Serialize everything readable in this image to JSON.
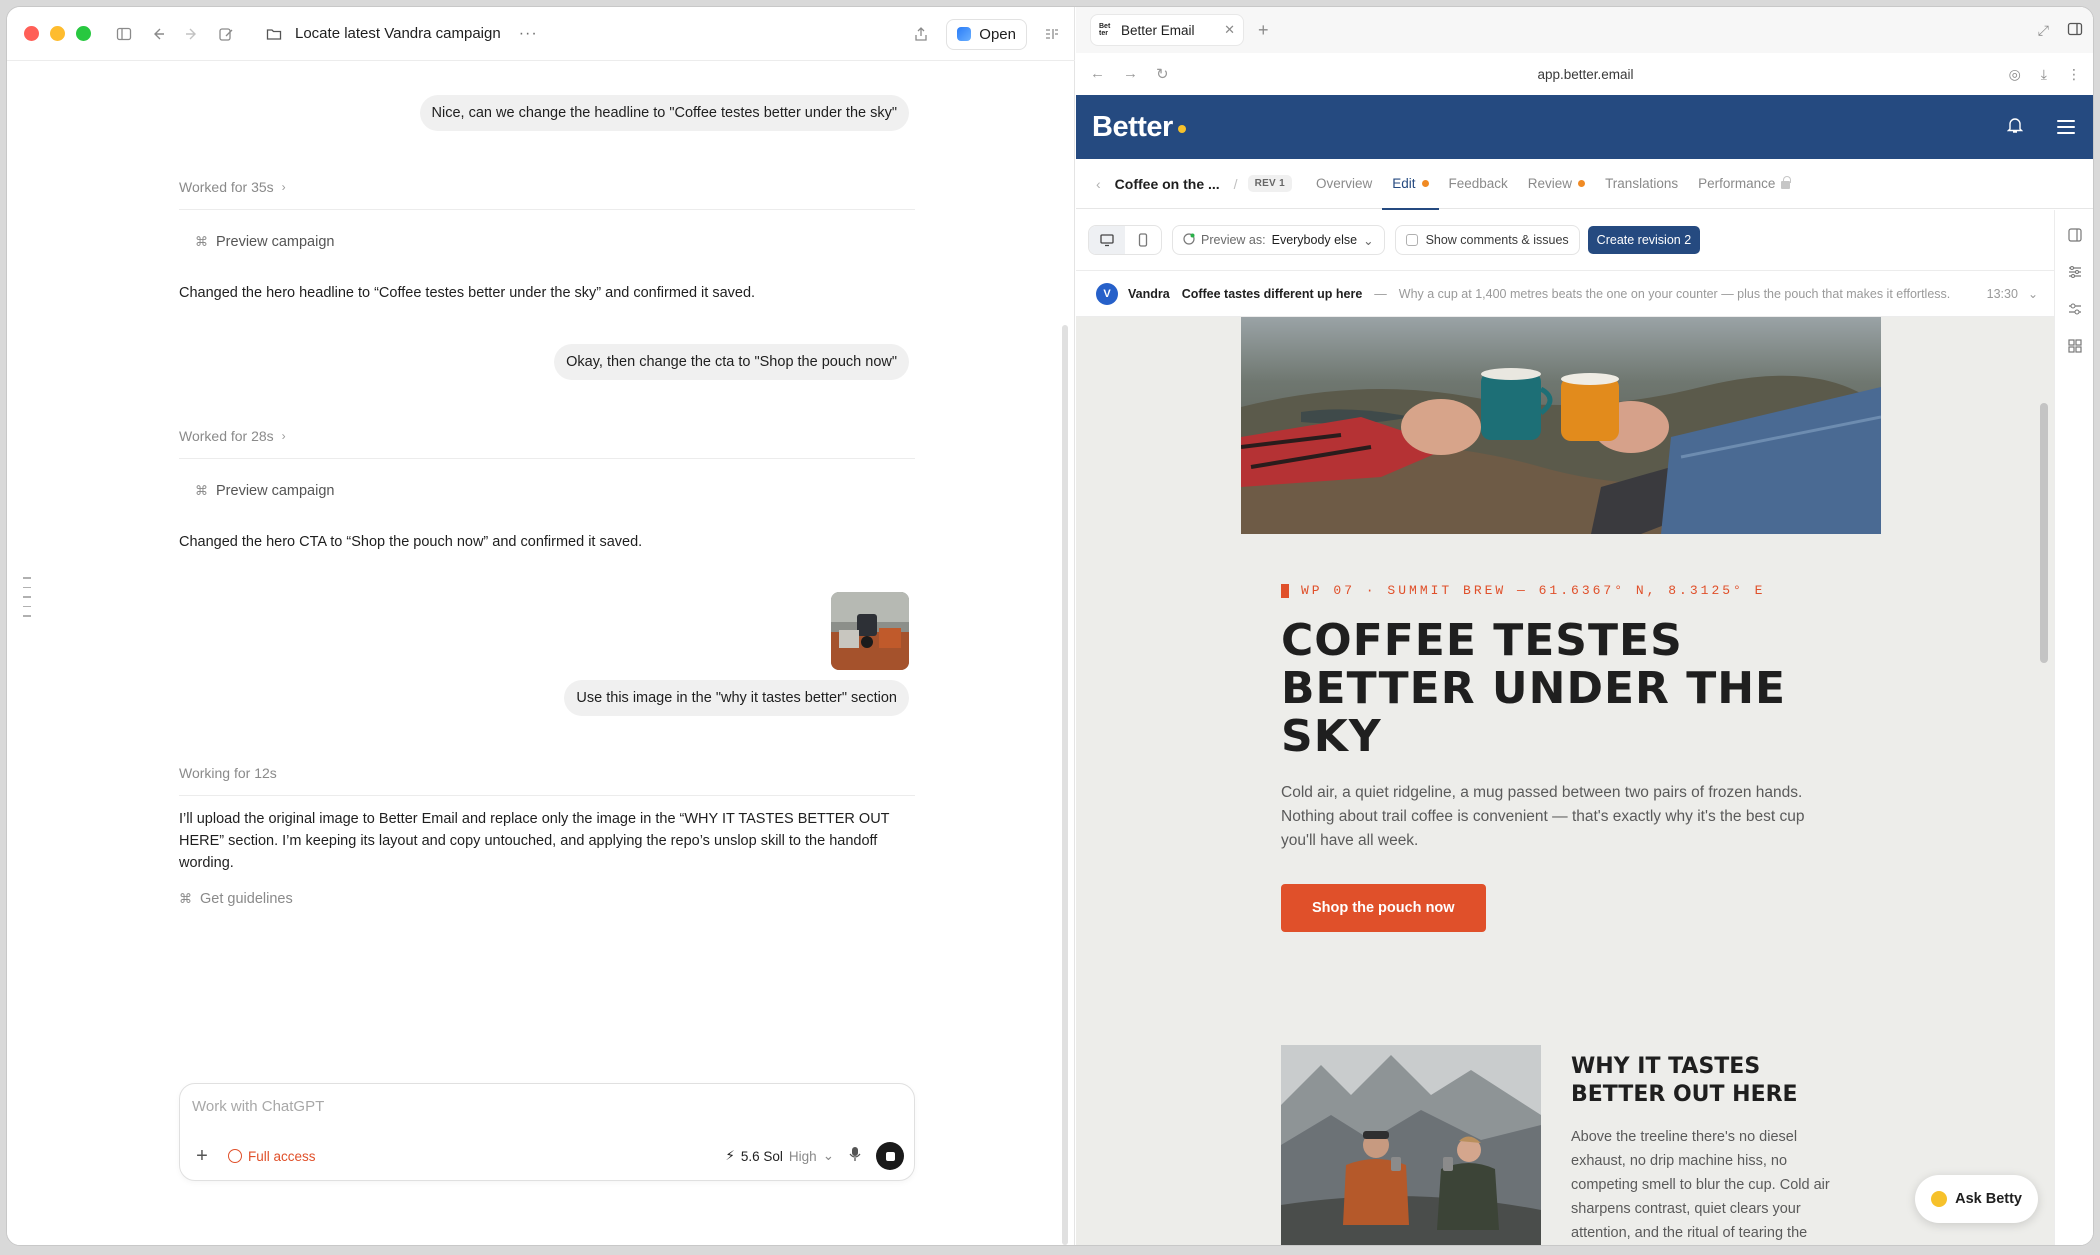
{
  "left": {
    "window_title": "Locate latest Vandra campaign",
    "more": "···",
    "open_label": "Open",
    "messages": {
      "user1": "Nice, can we change the headline to \"Coffee testes better under the sky\"",
      "worked1": "Worked for 35s",
      "tool1": "Preview campaign",
      "reply1": "Changed the hero headline to “Coffee testes better under the sky” and confirmed it saved.",
      "user2": "Okay, then change the cta to \"Shop the pouch now\"",
      "worked2": "Worked for 28s",
      "tool2": "Preview campaign",
      "reply2": "Changed the hero CTA to “Shop the pouch now” and confirmed it saved.",
      "user3": "Use this image in the \"why it tastes better\" section",
      "working3": "Working for 12s",
      "reply3": "I’ll upload the original image to Better Email and replace only the image in the “WHY IT TASTES BETTER OUT HERE” section. I’m keeping its layout and copy untouched, and applying the repo’s unslop skill to the handoff wording.",
      "tool3": "Get guidelines"
    },
    "composer": {
      "placeholder": "Work with ChatGPT",
      "access": "Full access",
      "model": "5.6 Sol",
      "effort": "High"
    }
  },
  "browser": {
    "tab_title": "Better Email",
    "favicon_text": "Bet ter",
    "url": "app.better.email"
  },
  "app": {
    "logo": "Better",
    "campaign": "Coffee on the ...",
    "revision": "REV 1",
    "tabs": [
      "Overview",
      "Edit",
      "Feedback",
      "Review",
      "Translations",
      "Performance"
    ],
    "preview_as_label": "Preview as:",
    "preview_as_value": "Everybody else",
    "show_comments": "Show comments & issues",
    "create_revision": "Create revision 2",
    "sender_initial": "V",
    "sender": "Vandra",
    "subject": "Coffee tastes different up here",
    "preheader_dash": "—",
    "preheader": "Why a cup at 1,400 metres beats the one on your counter — plus the pouch that makes it effortless.",
    "time": "13:30",
    "ask_betty": "Ask Betty"
  },
  "email": {
    "eyebrow": "WP 07 · SUMMIT BREW — 61.6367° N, 8.3125° E",
    "headline": "COFFEE TESTES BETTER UNDER THE SKY",
    "body": "Cold air, a quiet ridgeline, a mug passed between two pairs of frozen hands. Nothing about trail coffee is convenient — that's exactly why it's the best cup you'll have all week.",
    "cta": "Shop the pouch now",
    "why_title": "WHY IT TASTES BETTER OUT HERE",
    "why_body": "Above the treeline there's no diesel exhaust, no drip machine hiss, no competing smell to blur the cup. Cold air sharpens contrast, quiet clears your attention, and the ritual of tearing the"
  },
  "colors": {
    "header_blue": "#254a80",
    "accent_orange": "#e0502a",
    "logo_yellow": "#f6c12b",
    "status_orange": "#f08a24"
  }
}
